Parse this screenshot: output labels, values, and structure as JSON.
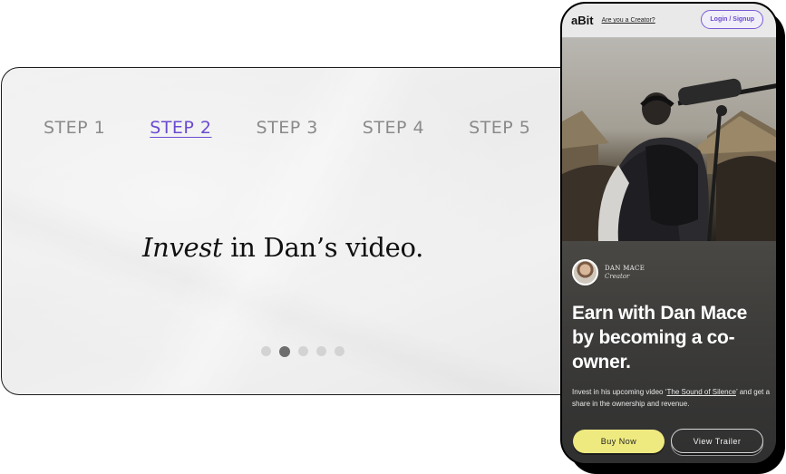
{
  "steps_card": {
    "steps": [
      {
        "label": "STEP 1",
        "active": false
      },
      {
        "label": "STEP 2",
        "active": true
      },
      {
        "label": "STEP 3",
        "active": false
      },
      {
        "label": "STEP 4",
        "active": false
      },
      {
        "label": "STEP 5",
        "active": false
      }
    ],
    "headline_emphasis": "Invest",
    "headline_rest": " in Dan’s video.",
    "pagination": {
      "total": 5,
      "current": 2
    }
  },
  "phone": {
    "topbar": {
      "logo": "aBit",
      "creator_link": "Are you a Creator?",
      "login_label": "Login / Signup"
    },
    "hero_image": "person-with-boom-microphone-in-village",
    "creator": {
      "name": "DAN MACE",
      "role": "Creator"
    },
    "title": "Earn with Dan Mace by becoming a co-owner.",
    "description_prefix": "Invest in his upcoming video ‘",
    "video_name": "The Sound of Silence",
    "description_suffix": "’ and get a share in the ownership and revenue.",
    "buy_label": "Buy Now",
    "trailer_label": "View Trailer"
  },
  "colors": {
    "accent_purple": "#6a4bd1",
    "buy_button": "#eeea80",
    "phone_dark": "#3d3c3a"
  }
}
